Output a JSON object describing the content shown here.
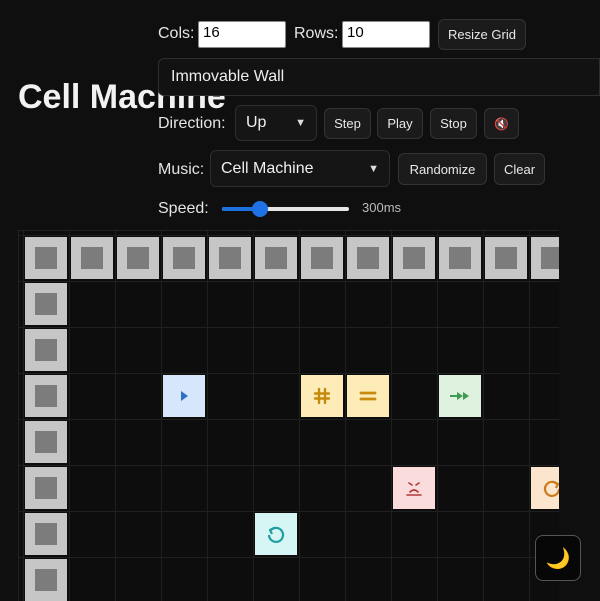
{
  "app": {
    "title": "Cell Machine"
  },
  "controls": {
    "cols_label": "Cols:",
    "cols_value": "16",
    "rows_label": "Rows:",
    "rows_value": "10",
    "resize_label": "Resize Grid",
    "selected_tool": "Immovable Wall",
    "direction_label": "Direction:",
    "direction_value": "Up",
    "step_label": "Step",
    "play_label": "Play",
    "stop_label": "Stop",
    "mute_icon": "🔇",
    "music_label": "Music:",
    "music_value": "Cell Machine",
    "randomize_label": "Randomize",
    "clear_label": "Clear",
    "speed_label": "Speed:",
    "speed_value": "300ms",
    "speed_fraction": 0.3
  },
  "theme_toggle": {
    "icon": "🌙",
    "icon_name": "moon-icon"
  },
  "colors": {
    "wall": "#c6c6c6",
    "wall_inner": "#7c7c7c",
    "slider_accent": "#1f72e6"
  },
  "grid": {
    "cells": [
      {
        "col": 0,
        "row": 0,
        "type": "immovable-wall"
      },
      {
        "col": 1,
        "row": 0,
        "type": "immovable-wall"
      },
      {
        "col": 2,
        "row": 0,
        "type": "immovable-wall"
      },
      {
        "col": 3,
        "row": 0,
        "type": "immovable-wall"
      },
      {
        "col": 4,
        "row": 0,
        "type": "immovable-wall"
      },
      {
        "col": 5,
        "row": 0,
        "type": "immovable-wall"
      },
      {
        "col": 6,
        "row": 0,
        "type": "immovable-wall"
      },
      {
        "col": 7,
        "row": 0,
        "type": "immovable-wall"
      },
      {
        "col": 8,
        "row": 0,
        "type": "immovable-wall"
      },
      {
        "col": 9,
        "row": 0,
        "type": "immovable-wall"
      },
      {
        "col": 10,
        "row": 0,
        "type": "immovable-wall"
      },
      {
        "col": 11,
        "row": 0,
        "type": "immovable-wall"
      },
      {
        "col": 0,
        "row": 1,
        "type": "immovable-wall"
      },
      {
        "col": 0,
        "row": 2,
        "type": "immovable-wall"
      },
      {
        "col": 0,
        "row": 3,
        "type": "immovable-wall"
      },
      {
        "col": 0,
        "row": 4,
        "type": "immovable-wall"
      },
      {
        "col": 0,
        "row": 5,
        "type": "immovable-wall"
      },
      {
        "col": 0,
        "row": 6,
        "type": "immovable-wall"
      },
      {
        "col": 0,
        "row": 7,
        "type": "immovable-wall"
      },
      {
        "col": 3,
        "row": 3,
        "type": "mover",
        "icon": "play-arrow-icon",
        "bg": "#d6e6fb",
        "fg": "#2f6fc4"
      },
      {
        "col": 6,
        "row": 3,
        "type": "hash-cell",
        "icon": "hash-icon",
        "bg": "#fdecb8",
        "fg": "#c68a0c"
      },
      {
        "col": 7,
        "row": 3,
        "type": "equals-cell",
        "icon": "equals-icon",
        "bg": "#fdecb8",
        "fg": "#c68a0c"
      },
      {
        "col": 9,
        "row": 3,
        "type": "generator",
        "icon": "double-arrow-icon",
        "bg": "#dff1df",
        "fg": "#3e9b52"
      },
      {
        "col": 8,
        "row": 5,
        "type": "enemy",
        "icon": "enemy-face-icon",
        "bg": "#fbdcdc",
        "fg": "#b03a3a"
      },
      {
        "col": 11,
        "row": 5,
        "type": "rotator-cw",
        "icon": "rotate-cw-icon",
        "bg": "#fbe5cc",
        "fg": "#cc7a1e"
      },
      {
        "col": 5,
        "row": 6,
        "type": "rotator-ccw",
        "icon": "rotate-ccw-icon",
        "bg": "#d6f5f5",
        "fg": "#1f9ea1"
      }
    ]
  }
}
